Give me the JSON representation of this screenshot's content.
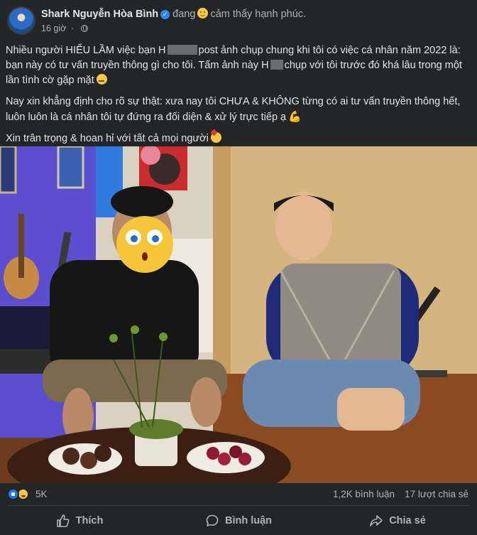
{
  "post": {
    "author": "Shark Nguyễn Hòa Bình",
    "feeling_prefix": "đang",
    "feeling": "cảm thấy hạnh phúc.",
    "time": "16 giờ",
    "paragraph1_a": "Nhiều người HIỂU LẦM việc bạn H",
    "paragraph1_b": "post ảnh chụp chung khi tôi có việc cá nhân năm 2022 là: bạn này có tư vấn truyền thông gì cho tôi. Tấm ảnh này H",
    "paragraph1_c": "chụp với tôi trước đó khá lâu trong một lần tình cờ gặp mặt",
    "paragraph2": "Nay xin khẳng định cho rõ sự thật: xưa nay tôi CHƯA & KHÔNG từng có ai tư vấn truyền thông hết, luôn luôn là cá nhân tôi tự đứng ra đối diện & xử lý trực tiếp ạ",
    "paragraph3": "Xin trân trọng & hoan hỉ với tất cả mọi người"
  },
  "stats": {
    "reactions": "5K",
    "comments": "1,2K bình luận",
    "shares": "17 lượt chia sẻ"
  },
  "actions": {
    "like": "Thích",
    "comment": "Bình luận",
    "share": "Chia sẻ"
  },
  "colors": {
    "background": "#242526",
    "text": "#e4e6eb",
    "secondary": "#b0b3b8",
    "brand": "#1877f2"
  }
}
